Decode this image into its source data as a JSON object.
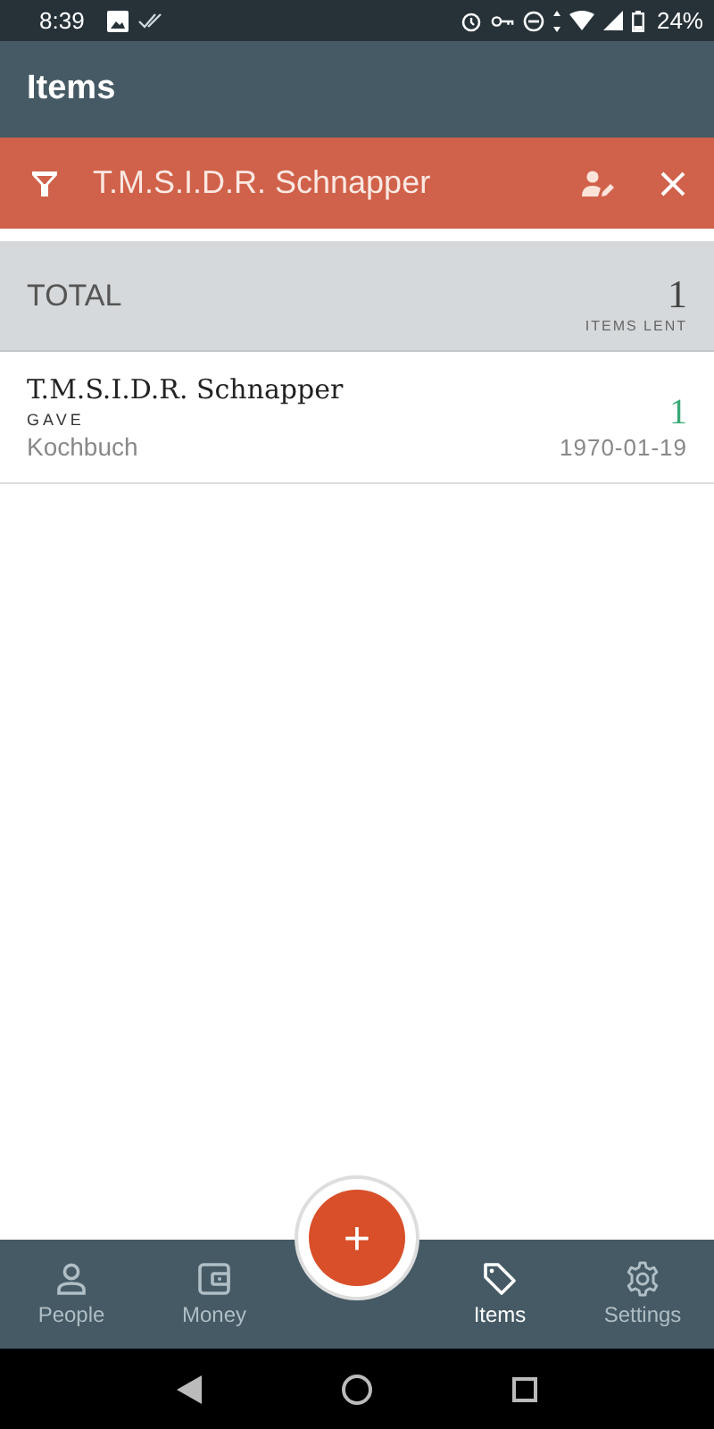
{
  "status_bar": {
    "time": "8:39",
    "battery": "24%"
  },
  "app_bar": {
    "title": "Items"
  },
  "filter": {
    "text": "T.M.S.I.D.R. Schnapper"
  },
  "total": {
    "label": "TOTAL",
    "count": "1",
    "caption": "ITEMS LENT"
  },
  "entries": [
    {
      "person": "T.M.S.I.D.R. Schnapper",
      "action": "GAVE",
      "item": "Kochbuch",
      "count": "1",
      "date": "1970-01-19"
    }
  ],
  "fab": {
    "label": "+"
  },
  "tabs": [
    {
      "kind": "person",
      "label": "People",
      "selected": false
    },
    {
      "kind": "wallet",
      "label": "Money",
      "selected": false
    },
    {
      "kind": "gap"
    },
    {
      "kind": "tag",
      "label": "Items",
      "selected": true
    },
    {
      "kind": "gear",
      "label": "Settings",
      "selected": false
    }
  ]
}
